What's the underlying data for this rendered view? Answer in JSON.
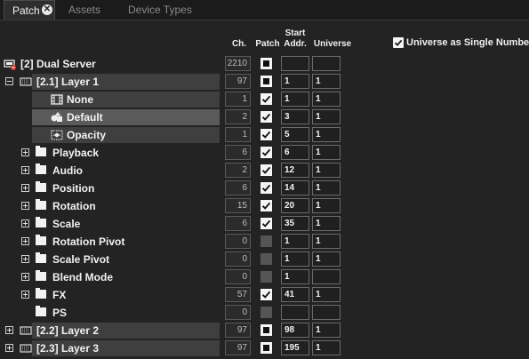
{
  "tabs": [
    {
      "label": "Patch",
      "active": true
    },
    {
      "label": "Assets",
      "active": false
    },
    {
      "label": "Device Types",
      "active": false
    }
  ],
  "headers": {
    "ch": "Ch.",
    "patch": "Patch",
    "start_line1": "Start",
    "start_line2": "Addr.",
    "universe": "Universe"
  },
  "universe_option": {
    "label": "Universe as Single Number",
    "checked": true
  },
  "rows": [
    {
      "label": "[2] Dual Server",
      "ch": "2210",
      "patch": "solid",
      "addr": "",
      "uni": ""
    },
    {
      "label": "[2.1] Layer 1",
      "ch": "97",
      "patch": "solid",
      "addr": "1",
      "uni": "1"
    },
    {
      "label": "None",
      "ch": "1",
      "patch": "check",
      "addr": "1",
      "uni": "1"
    },
    {
      "label": "Default",
      "ch": "2",
      "patch": "check",
      "addr": "3",
      "uni": "1"
    },
    {
      "label": "Opacity",
      "ch": "1",
      "patch": "check",
      "addr": "5",
      "uni": "1"
    },
    {
      "label": "Playback",
      "ch": "6",
      "patch": "check",
      "addr": "6",
      "uni": "1"
    },
    {
      "label": "Audio",
      "ch": "2",
      "patch": "check",
      "addr": "12",
      "uni": "1"
    },
    {
      "label": "Position",
      "ch": "6",
      "patch": "check",
      "addr": "14",
      "uni": "1"
    },
    {
      "label": "Rotation",
      "ch": "15",
      "patch": "check",
      "addr": "20",
      "uni": "1"
    },
    {
      "label": "Scale",
      "ch": "6",
      "patch": "check",
      "addr": "35",
      "uni": "1"
    },
    {
      "label": "Rotation Pivot",
      "ch": "0",
      "patch": "disabled",
      "addr": "1",
      "uni": "1"
    },
    {
      "label": "Scale Pivot",
      "ch": "0",
      "patch": "disabled",
      "addr": "1",
      "uni": "1"
    },
    {
      "label": "Blend Mode",
      "ch": "0",
      "patch": "disabled",
      "addr": "1",
      "uni": ""
    },
    {
      "label": "FX",
      "ch": "57",
      "patch": "check",
      "addr": "41",
      "uni": "1"
    },
    {
      "label": "PS",
      "ch": "0",
      "patch": "disabled",
      "addr": "",
      "uni": ""
    },
    {
      "label": "[2.2] Layer 2",
      "ch": "97",
      "patch": "solid",
      "addr": "98",
      "uni": "1"
    },
    {
      "label": "[2.3] Layer 3",
      "ch": "97",
      "patch": "solid",
      "addr": "195",
      "uni": "1"
    }
  ]
}
